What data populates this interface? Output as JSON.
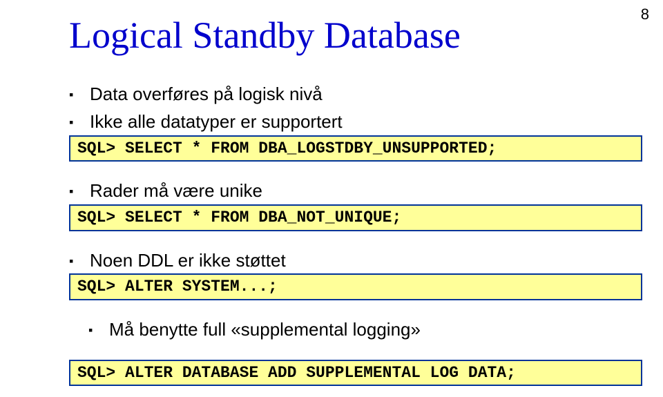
{
  "page_number": "8",
  "title": "Logical Standby Database",
  "bullets": {
    "b1": "Data overføres på logisk nivå",
    "b2": "Ikke alle datatyper er supportert",
    "b3": "Rader må være unike",
    "b4": "Noen DDL er ikke støttet",
    "b5": "Må benytte full «supplemental logging»"
  },
  "code": {
    "c1": "SQL> SELECT * FROM DBA_LOGSTDBY_UNSUPPORTED;",
    "c2": "SQL> SELECT * FROM DBA_NOT_UNIQUE;",
    "c3": "SQL> ALTER SYSTEM...;",
    "c4": "SQL> ALTER DATABASE ADD SUPPLEMENTAL LOG DATA;"
  }
}
